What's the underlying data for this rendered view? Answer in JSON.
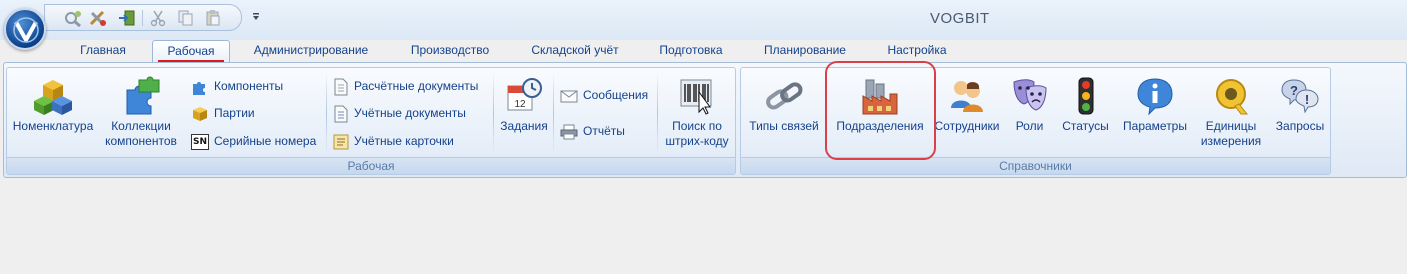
{
  "app": {
    "title": "VOGBIT"
  },
  "quick_access": {
    "icons": [
      "settings-wrench-icon",
      "tools-cross-icon",
      "exit-door-icon",
      "cut-icon",
      "copy-icon",
      "paste-icon"
    ],
    "dropdown_icon": "dropdown-arrow-icon"
  },
  "tabs": [
    {
      "label": "Главная",
      "active": false
    },
    {
      "label": "Рабочая",
      "active": true
    },
    {
      "label": "Администрирование",
      "active": false
    },
    {
      "label": "Производство",
      "active": false
    },
    {
      "label": "Складской учёт",
      "active": false
    },
    {
      "label": "Подготовка",
      "active": false
    },
    {
      "label": "Планирование",
      "active": false
    },
    {
      "label": "Настройка",
      "active": false
    }
  ],
  "groups": {
    "rabochaya": {
      "label": "Рабочая",
      "nomenclature": {
        "label": "Номенклатура",
        "icon": "cubes-icon"
      },
      "collections": {
        "line1": "Коллекции",
        "line2": "компонентов",
        "icon": "puzzle-icon"
      },
      "components": {
        "label": "Компоненты",
        "icon": "puzzle-small-icon"
      },
      "parts": {
        "label": "Партии",
        "icon": "box-icon"
      },
      "serials": {
        "label": "Серийные номера",
        "icon": "serial-number-icon",
        "icon_text": "SN"
      },
      "calc_docs": {
        "label": "Расчётные документы",
        "icon": "document-icon"
      },
      "acct_docs": {
        "label": "Учётные документы",
        "icon": "document-lines-icon"
      },
      "acct_cards": {
        "label": "Учётные карточки",
        "icon": "card-icon"
      },
      "tasks": {
        "label": "Задания",
        "icon": "calendar-clock-icon",
        "calendar_day": "12"
      },
      "messages": {
        "label": "Сообщения",
        "icon": "envelope-icon"
      },
      "reports": {
        "label": "Отчёты",
        "icon": "printer-icon"
      },
      "barcode_search": {
        "line1": "Поиск по",
        "line2": "штрих-коду",
        "icon": "barcode-scanner-icon"
      }
    },
    "spravochniki": {
      "label": "Справочники",
      "link_types": {
        "label": "Типы связей",
        "icon": "chain-link-icon"
      },
      "departments": {
        "label": "Подразделения",
        "icon": "factory-icon"
      },
      "employees": {
        "label": "Сотрудники",
        "icon": "users-icon"
      },
      "roles": {
        "label": "Роли",
        "icon": "theater-masks-icon"
      },
      "statuses": {
        "label": "Статусы",
        "icon": "traffic-light-icon"
      },
      "parameters": {
        "label": "Параметры",
        "icon": "info-icon"
      },
      "units": {
        "line1": "Единицы",
        "line2": "измерения",
        "icon": "measuring-tape-icon"
      },
      "requests": {
        "label": "Запросы",
        "icon": "question-bubbles-icon"
      }
    }
  },
  "annotations": {
    "highlight_target": "Подразделения",
    "highlight_color": "#d9404a",
    "tab_underline_color": "#e01818"
  }
}
